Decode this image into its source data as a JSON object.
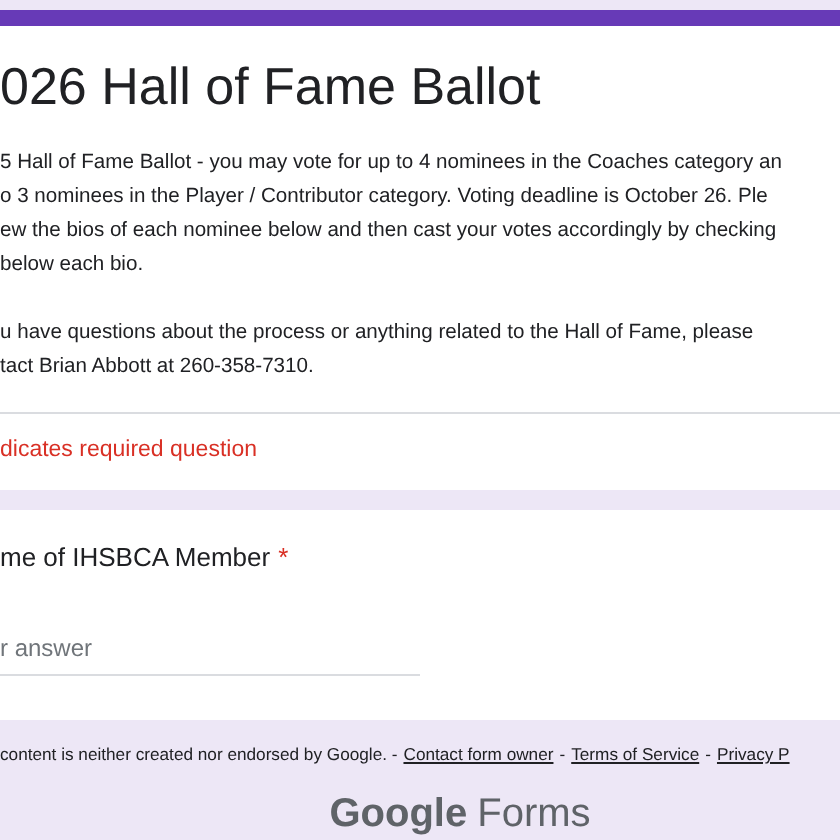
{
  "header": {
    "title": "026 Hall of Fame Ballot",
    "description_lines": [
      "5 Hall of Fame Ballot - you may vote for up to 4 nominees in the Coaches category an",
      "o 3 nominees in the Player / Contributor category.  Voting deadline is October 26.  Ple",
      "ew the bios of each nominee below and then cast your votes accordingly by checking",
      "below each bio."
    ],
    "contact_lines": [
      "u have questions about the process or anything related to the Hall of Fame, please",
      "tact Brian Abbott at 260-358-7310."
    ],
    "required_note": "dicates required question"
  },
  "question": {
    "label": "me of IHSBCA Member",
    "required": true,
    "required_mark": "*",
    "placeholder": "r answer"
  },
  "footer": {
    "disclaimer": "content is neither created nor endorsed by Google. -",
    "links": [
      "Contact form owner",
      "Terms of Service",
      "Privacy P"
    ],
    "separator": "-",
    "logo_word": "Google",
    "logo_product": "Forms"
  }
}
